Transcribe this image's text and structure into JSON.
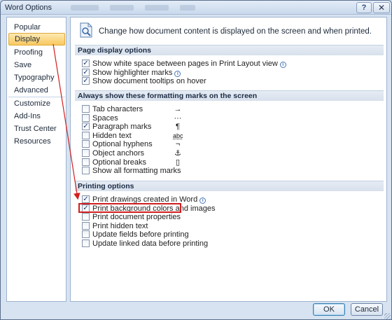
{
  "window": {
    "title": "Word Options",
    "help_label": "?",
    "close_label": "✕"
  },
  "sidebar": {
    "items": [
      {
        "label": "Popular"
      },
      {
        "label": "Display"
      },
      {
        "label": "Proofing"
      },
      {
        "label": "Save"
      },
      {
        "label": "Typography"
      },
      {
        "label": "Advanced"
      },
      {
        "label": "Customize"
      },
      {
        "label": "Add-Ins"
      },
      {
        "label": "Trust Center"
      },
      {
        "label": "Resources"
      }
    ],
    "selected": "Display"
  },
  "main": {
    "header_text": "Change how document content is displayed on the screen and when printed.",
    "sections": [
      {
        "title": "Page display options",
        "options": [
          {
            "label": "Show white space between pages in Print Layout view",
            "checked": true,
            "info": true
          },
          {
            "label": "Show highlighter marks",
            "checked": true,
            "info": true
          },
          {
            "label": "Show document tooltips on hover",
            "checked": true,
            "info": false
          }
        ]
      },
      {
        "title": "Always show these formatting marks on the screen",
        "options": [
          {
            "label": "Tab characters",
            "checked": false,
            "mark": "→"
          },
          {
            "label": "Spaces",
            "checked": false,
            "mark": "···"
          },
          {
            "label": "Paragraph marks",
            "checked": true,
            "mark": "¶"
          },
          {
            "label": "Hidden text",
            "checked": false,
            "mark": "abc"
          },
          {
            "label": "Optional hyphens",
            "checked": false,
            "mark": "¬"
          },
          {
            "label": "Object anchors",
            "checked": false,
            "mark": "⚓"
          },
          {
            "label": "Optional breaks",
            "checked": false,
            "mark": "▯"
          },
          {
            "label": "Show all formatting marks",
            "checked": false,
            "mark": ""
          }
        ]
      },
      {
        "title": "Printing options",
        "options": [
          {
            "label": "Print drawings created in Word",
            "checked": true,
            "info": true
          },
          {
            "label": "Print background colors and images",
            "checked": true,
            "info": false
          },
          {
            "label": "Print document properties",
            "checked": false,
            "info": false
          },
          {
            "label": "Print hidden text",
            "checked": false,
            "info": false
          },
          {
            "label": "Update fields before printing",
            "checked": false,
            "info": false
          },
          {
            "label": "Update linked data before printing",
            "checked": false,
            "info": false
          }
        ]
      }
    ]
  },
  "footer": {
    "ok_label": "OK",
    "cancel_label": "Cancel"
  },
  "checkmark_glyph": "✓",
  "info_glyph": "i",
  "colors": {
    "selected_nav": "#f8c860",
    "annotation_red": "#d11f1f"
  }
}
